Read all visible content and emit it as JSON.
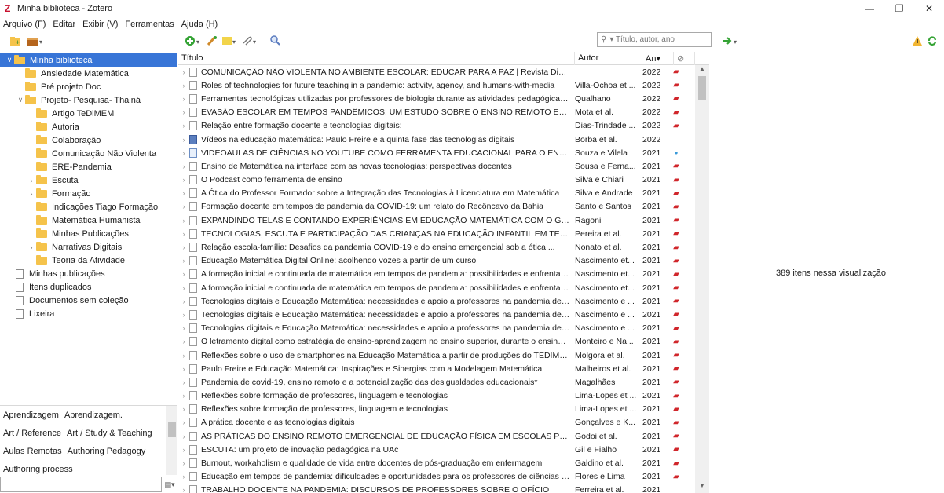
{
  "window": {
    "title": "Minha biblioteca - Zotero",
    "minimize": "—",
    "maximize": "❐",
    "close": "✕"
  },
  "menu": [
    "Arquivo (F)",
    "Editar",
    "Exibir (V)",
    "Ferramentas",
    "Ajuda (H)"
  ],
  "search": {
    "placeholder": "▾ Título, autor, ano"
  },
  "collections": [
    {
      "label": "Minha biblioteca",
      "kind": "library",
      "level": 0,
      "twisty": "∨",
      "selected": true
    },
    {
      "label": "Ansiedade Matemática",
      "kind": "folder",
      "level": 1
    },
    {
      "label": "Pré projeto Doc",
      "kind": "folder",
      "level": 1
    },
    {
      "label": "Projeto- Pesquisa- Thainá",
      "kind": "folder",
      "level": 1,
      "twisty": "∨"
    },
    {
      "label": "Artigo TeDiMEM",
      "kind": "folder",
      "level": 2
    },
    {
      "label": "Autoria",
      "kind": "folder",
      "level": 2
    },
    {
      "label": "Colaboração",
      "kind": "folder",
      "level": 2
    },
    {
      "label": "Comunicação Não Violenta",
      "kind": "folder",
      "level": 2
    },
    {
      "label": "ERE-Pandemia",
      "kind": "folder",
      "level": 2
    },
    {
      "label": "Escuta",
      "kind": "folder",
      "level": 2,
      "twisty": "›"
    },
    {
      "label": "Formação",
      "kind": "folder",
      "level": 2,
      "twisty": "›"
    },
    {
      "label": "Indicações Tiago Formação",
      "kind": "folder",
      "level": 2
    },
    {
      "label": "Matemática Humanista",
      "kind": "folder",
      "level": 2
    },
    {
      "label": "Minhas Publicações",
      "kind": "folder",
      "level": 2
    },
    {
      "label": "Narrativas Digitais",
      "kind": "folder",
      "level": 2,
      "twisty": "›"
    },
    {
      "label": "Teoria da Atividade",
      "kind": "folder",
      "level": 2
    },
    {
      "label": "Minhas publicações",
      "kind": "doc",
      "level": 0
    },
    {
      "label": "Itens duplicados",
      "kind": "doc",
      "level": 0
    },
    {
      "label": "Documentos sem coleção",
      "kind": "doc",
      "level": 0
    },
    {
      "label": "Lixeira",
      "kind": "doc",
      "level": 0
    }
  ],
  "tags": [
    [
      "Aprendizagem",
      "Aprendizagem."
    ],
    [
      "Art / Reference",
      "Art / Study & Teaching"
    ],
    [
      "Aulas Remotas",
      "Authoring Pedagogy"
    ],
    [
      "Authoring process"
    ]
  ],
  "columns": {
    "title": "Título",
    "author": "Autor",
    "year": "An▾",
    "attach": "⊘"
  },
  "items": [
    {
      "title": "COMUNICAÇÃO NÃO VIOLENTA NO AMBIENTE ESCOLAR: EDUCAR PARA A PAZ | Revista Diálogos A...",
      "author": "",
      "year": "2022",
      "type": "doc",
      "att": "pdf"
    },
    {
      "title": "Roles of technologies for future teaching in a pandemic: activity, agency, and humans-with-media",
      "author": "Villa-Ochoa et ...",
      "year": "2022",
      "type": "doc",
      "att": "pdf"
    },
    {
      "title": "Ferramentas tecnológicas utilizadas por professores de biologia durante as atividades pedagógicas nã...",
      "author": "Qualhano",
      "year": "2022",
      "type": "doc",
      "att": "pdf"
    },
    {
      "title": "EVASÃO ESCOLAR EM TEMPOS PANDÊMICOS: UM ESTUDO SOBRE O ENSINO REMOTO EMERGENCIA...",
      "author": "Mota et al.",
      "year": "2022",
      "type": "doc",
      "att": "pdf"
    },
    {
      "title": "Relação entre formação docente e tecnologias digitais:",
      "author": "Dias-Trindade ...",
      "year": "2022",
      "type": "doc",
      "att": "pdf"
    },
    {
      "title": "Vídeos na educação matemática: Paulo Freire e a quinta fase das tecnologias digitais",
      "author": "Borba et al.",
      "year": "2022",
      "type": "book",
      "att": ""
    },
    {
      "title": "VIDEOAULAS DE CIÊNCIAS NO YOUTUBE COMO FERRAMENTA EDUCACIONAL PARA O ENSINO FUN...",
      "author": "Souza e Vilela",
      "year": "2021",
      "type": "vid",
      "att": "dot"
    },
    {
      "title": "Ensino de Matemática na interface com as novas tecnologias: perspectivas docentes",
      "author": "Sousa e Ferna...",
      "year": "2021",
      "type": "doc",
      "att": "pdf"
    },
    {
      "title": "O Podcast como ferramenta de ensino",
      "author": "Silva e Chiari",
      "year": "2021",
      "type": "doc",
      "att": "pdf"
    },
    {
      "title": "A Ótica do Professor Formador sobre a Integração das Tecnologias à Licenciatura em Matemática",
      "author": "Silva e Andrade",
      "year": "2021",
      "type": "doc",
      "att": "pdf"
    },
    {
      "title": "Formação docente em tempos de pandemia da COVID-19: um relato do Recôncavo da Bahia",
      "author": "Santo e Santos",
      "year": "2021",
      "type": "doc",
      "att": "pdf"
    },
    {
      "title": "EXPANDINDO TELAS E CONTANDO EXPERIÊNCIAS EM EDUCAÇÃO MATEMÁTICA COM O GEOGEBRA:...",
      "author": "Ragoni",
      "year": "2021",
      "type": "doc",
      "att": "pdf"
    },
    {
      "title": "TECNOLOGIAS, ESCUTA E PARTICIPAÇÃO DAS CRIANÇAS NA EDUCAÇÃO INFANTIL EM TEMPOS DE P...",
      "author": "Pereira et al.",
      "year": "2021",
      "type": "doc",
      "att": "pdf"
    },
    {
      "title": "Relação escola-família: Desafios da pandemia COVID-19 e do ensino emergencial sob a ótica ...",
      "author": "Nonato et al.",
      "year": "2021",
      "type": "doc",
      "att": "pdf"
    },
    {
      "title": "Educação Matemática Digital Online: acolhendo vozes a partir de um curso",
      "author": "Nascimento et...",
      "year": "2021",
      "type": "doc",
      "att": "pdf"
    },
    {
      "title": "A formação inicial e continuada de matemática em tempos de pandemia: possibilidades e enfrentam...",
      "author": "Nascimento et...",
      "year": "2021",
      "type": "doc",
      "att": "pdf"
    },
    {
      "title": "A formação inicial e continuada de matemática em tempos de pandemia: possibilidades e enfrentam...",
      "author": "Nascimento et...",
      "year": "2021",
      "type": "doc",
      "att": "pdf"
    },
    {
      "title": "Tecnologias digitais e Educação Matemática: necessidades e apoio a professores na pandemia de CO...",
      "author": "Nascimento e ...",
      "year": "2021",
      "type": "doc",
      "att": "pdf"
    },
    {
      "title": "Tecnologias digitais e Educação Matemática: necessidades e apoio a professores na pandemia de CO...",
      "author": "Nascimento e ...",
      "year": "2021",
      "type": "doc",
      "att": "pdf"
    },
    {
      "title": "Tecnologias digitais e Educação Matemática: necessidades e apoio a professores na pandemia de CO...",
      "author": "Nascimento e ...",
      "year": "2021",
      "type": "doc",
      "att": "pdf"
    },
    {
      "title": "O letramento digital como estratégia de ensino-aprendizagem no ensino superior, durante o ensino r...",
      "author": "Monteiro e Na...",
      "year": "2021",
      "type": "doc",
      "att": "pdf"
    },
    {
      "title": "Reflexões sobre o uso de smartphones na Educação Matemática a partir de produções do TEDIMEM: ...",
      "author": "Molgora et al.",
      "year": "2021",
      "type": "doc",
      "att": "pdf"
    },
    {
      "title": "Paulo Freire e Educação Matemática: Inspirações e Sinergias com a Modelagem Matemática",
      "author": "Malheiros et al.",
      "year": "2021",
      "type": "doc",
      "att": "pdf"
    },
    {
      "title": "Pandemia de covid-19, ensino remoto e a potencialização das desigualdades educacionais*",
      "author": "Magalhães",
      "year": "2021",
      "type": "doc",
      "att": "pdf"
    },
    {
      "title": "Reflexões sobre formação de professores, linguagem e tecnologias",
      "author": "Lima-Lopes et ...",
      "year": "2021",
      "type": "doc",
      "att": "pdf"
    },
    {
      "title": "Reflexões sobre formação de professores, linguagem e tecnologias",
      "author": "Lima-Lopes et ...",
      "year": "2021",
      "type": "doc",
      "att": "pdf"
    },
    {
      "title": "A prática docente e as tecnologias digitais",
      "author": "Gonçalves e K...",
      "year": "2021",
      "type": "doc",
      "att": "pdf"
    },
    {
      "title": "AS PRÁTICAS DO ENSINO REMOTO EMERGENCIAL DE EDUCAÇÃO FÍSICA EM ESCOLAS PÚBLICAS DU...",
      "author": "Godoi et al.",
      "year": "2021",
      "type": "doc",
      "att": "pdf"
    },
    {
      "title": "ESCUTA: um projeto de inovação pedagógica na UAc",
      "author": "Gil e Fialho",
      "year": "2021",
      "type": "doc",
      "att": "pdf"
    },
    {
      "title": "Burnout, workaholism e qualidade de vida entre docentes de pós-graduação em enfermagem",
      "author": "Galdino et al.",
      "year": "2021",
      "type": "doc",
      "att": "pdf"
    },
    {
      "title": "Educação em tempos de pandemia: dificuldades e oportunidades para os professores de ciências e m...",
      "author": "Flores e Lima",
      "year": "2021",
      "type": "doc",
      "att": "pdf"
    },
    {
      "title": "TRABALHO DOCENTE NA PANDEMIA: DISCURSOS DE PROFESSORES SOBRE O OFÍCIO",
      "author": "Ferreira et al.",
      "year": "2021",
      "type": "doc",
      "att": ""
    }
  ],
  "item_count": "389 itens nessa visualização",
  "colors": {
    "selection": "#3875d7",
    "folder": "#f5c34b",
    "pdf": "#d0262b",
    "zotero": "#c8102e"
  }
}
